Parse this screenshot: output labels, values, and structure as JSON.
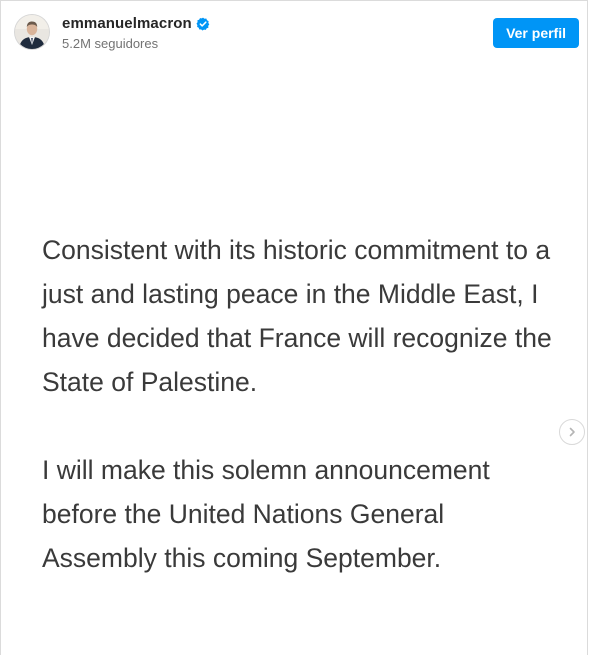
{
  "header": {
    "username": "emmanuelmacron",
    "verified_icon": "verified-badge-icon",
    "followers": "5.2M seguidores",
    "profile_button_label": "Ver perfil",
    "accent_color": "#0095f6"
  },
  "post": {
    "paragraphs": [
      "Consistent with its historic commitment to a just and lasting peace in the Middle East, I have decided that France will recognize the State of Palestine.",
      "I will make this solemn announcement before the United Nations General Assembly this coming September."
    ],
    "next_icon": "chevron-right-icon"
  }
}
